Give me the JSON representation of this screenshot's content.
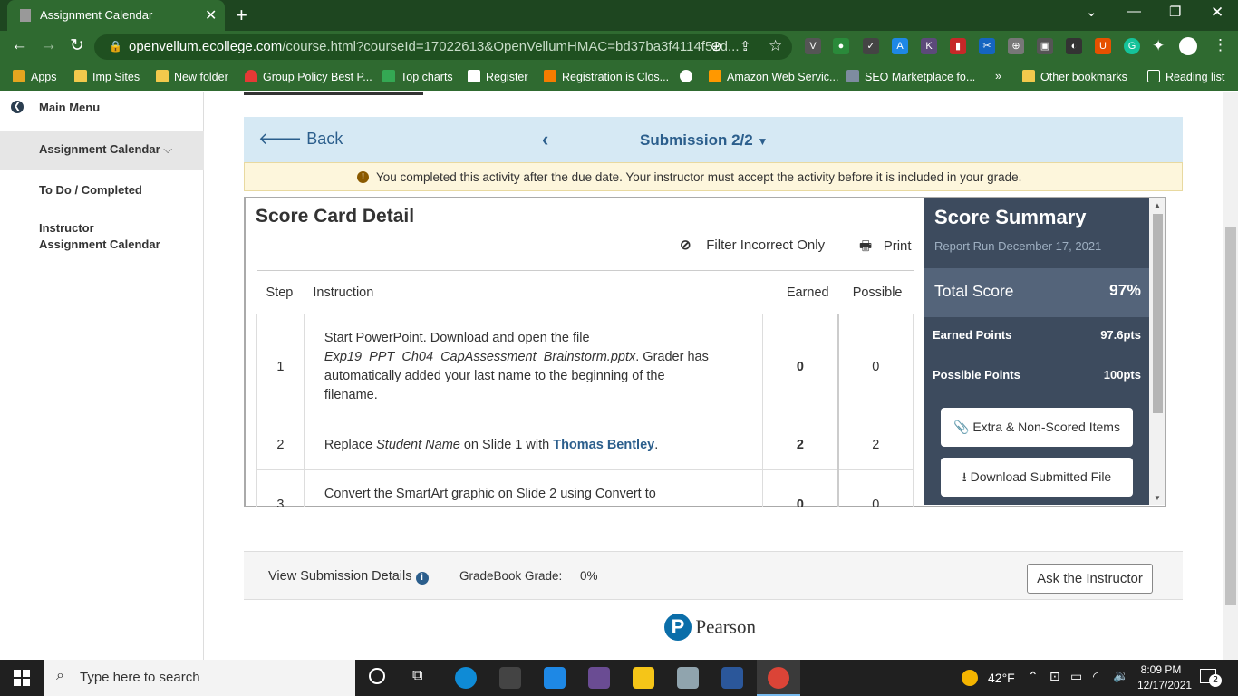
{
  "browser": {
    "tab_title": "Assignment Calendar",
    "url_domain": "openvellum.ecollege.com",
    "url_rest": "/course.html?courseId=17022613&OpenVellumHMAC=bd37ba3f4114f52d...",
    "bookmarks": [
      "Apps",
      "Imp Sites",
      "New folder",
      "Group Policy Best P...",
      "Top charts",
      "Register",
      "Registration is Clos...",
      "",
      "Amazon Web Servic...",
      "SEO Marketplace fo...",
      "»",
      "Other bookmarks",
      "Reading list"
    ]
  },
  "sidebar": {
    "main_menu": "Main Menu",
    "items": [
      {
        "label": "Assignment Calendar"
      },
      {
        "label": "To Do / Completed"
      },
      {
        "label": "Instructor"
      },
      {
        "label": "Assignment Calendar"
      }
    ]
  },
  "header": {
    "back": "Back",
    "submission": "Submission 2/2"
  },
  "notice": "You completed this activity after the due date. Your instructor must accept the activity before it is included in your grade.",
  "scorecard": {
    "title": "Score Card Detail",
    "filter": "Filter Incorrect Only",
    "print": "Print",
    "columns": [
      "Step",
      "Instruction",
      "Earned",
      "Possible"
    ],
    "rows": [
      {
        "step": "1",
        "pre": "Start PowerPoint. Download and open the file ",
        "em": "Exp19_PPT_Ch04_CapAssessment_Brainstorm.pptx",
        "post": ". Grader has automatically added your last name to the beginning of the filename.",
        "earned": "0",
        "possible": "0"
      },
      {
        "step": "2",
        "pre": "Replace ",
        "em": "Student Name",
        "mid": " on Slide 1 with ",
        "strong": "Thomas Bentley",
        "post": ".",
        "earned": "2",
        "possible": "2"
      },
      {
        "step": "3",
        "pre": "Convert the SmartArt graphic on Slide 2 using Convert to",
        "earned": "0",
        "possible": "0"
      }
    ]
  },
  "summary": {
    "title": "Score Summary",
    "date": "Report Run December 17, 2021",
    "total_label": "Total Score",
    "total_value": "97%",
    "earned_label": "Earned Points",
    "earned_value": "97.6pts",
    "possible_label": "Possible Points",
    "possible_value": "100pts",
    "extra_btn": "Extra & Non-Scored Items",
    "download_btn": "Download Submitted File"
  },
  "footer": {
    "view_details": "View Submission Details",
    "gradebook_label": "GradeBook Grade:",
    "gradebook_value": "0%",
    "ask": "Ask the Instructor",
    "brand": "Pearson"
  },
  "taskbar": {
    "search_placeholder": "Type here to search",
    "temp": "42°F",
    "time": "8:09 PM",
    "date": "12/17/2021",
    "notif_count": "2"
  },
  "colors": {
    "accent": "#2b5e8c",
    "summary_bg": "#3d4b5e",
    "chrome": "#2f6a30"
  }
}
